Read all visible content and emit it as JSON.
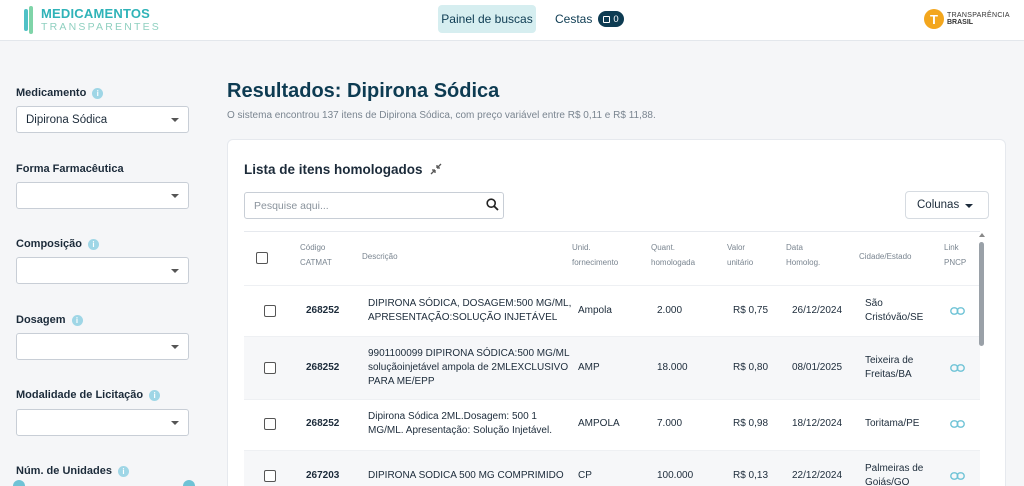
{
  "header": {
    "logo_line1": "MEDICAMENTOS",
    "logo_line2": "TRANSPARENTES",
    "nav_painel": "Painel de buscas",
    "nav_cestas": "Cestas",
    "cart_count": "0",
    "partner_line1": "TRANSPARÊNCIA",
    "partner_line2": "BRASIL",
    "partner_initial": "T"
  },
  "sidebar": {
    "filters": [
      {
        "label": "Medicamento",
        "value": "Dipirona Sódica",
        "info": true
      },
      {
        "label": "Forma Farmacêutica",
        "value": "",
        "info": false
      },
      {
        "label": "Composição",
        "value": "",
        "info": true
      },
      {
        "label": "Dosagem",
        "value": "",
        "info": true
      },
      {
        "label": "Modalidade de Licitação",
        "value": "",
        "info": true
      },
      {
        "label": "Núm. de Unidades",
        "value": "",
        "info": true
      }
    ]
  },
  "main": {
    "title": "Resultados: Dipirona Sódica",
    "subtitle": "O sistema encontrou 137 itens de Dipirona Sódica, com preço variável entre R$ 0,11 e R$ 11,88.",
    "card_title": "Lista de itens homologados",
    "search_placeholder": "Pesquise aqui...",
    "columns_label": "Colunas"
  },
  "table": {
    "headers": {
      "codigo": [
        "Código",
        "CATMAT"
      ],
      "descricao": [
        "Descrição"
      ],
      "unid": [
        "Unid.",
        "fornecimento"
      ],
      "quant": [
        "Quant.",
        "homologada"
      ],
      "valor": [
        "Valor",
        "unitário"
      ],
      "data": [
        "Data",
        "Homolog."
      ],
      "cidade": [
        "Cidade/Estado"
      ],
      "link": [
        "Link",
        "PNCP"
      ]
    },
    "rows": [
      {
        "codigo": "268252",
        "descricao": [
          "DIPIRONA SÓDICA, DOSAGEM:500 MG/ML,",
          "APRESENTAÇÃO:SOLUÇÃO INJETÁVEL"
        ],
        "unid": "Ampola",
        "quant": "2.000",
        "valor": "R$ 0,75",
        "data": "26/12/2024",
        "cidade": [
          "São",
          "Cristóvão/SE"
        ]
      },
      {
        "codigo": "268252",
        "descricao": [
          "9901100099 DIPIRONA SÓDICA:500 MG/ML",
          "soluçãoinjetável ampola de 2MLEXCLUSIVO",
          "PARA ME/EPP"
        ],
        "unid": "AMP",
        "quant": "18.000",
        "valor": "R$ 0,80",
        "data": "08/01/2025",
        "cidade": [
          "Teixeira de",
          "Freitas/BA"
        ]
      },
      {
        "codigo": "268252",
        "descricao": [
          "Dipirona Sódica 2ML.Dosagem: 500 1",
          "MG/ML. Apresentação: Solução Injetável."
        ],
        "unid": "AMPOLA",
        "quant": "7.000",
        "valor": "R$ 0,98",
        "data": "18/12/2024",
        "cidade": [
          "Toritama/PE"
        ]
      },
      {
        "codigo": "267203",
        "descricao": [
          "DIPIRONA SODICA 500 MG COMPRIMIDO"
        ],
        "unid": "CP",
        "quant": "100.000",
        "valor": "R$ 0,13",
        "data": "22/12/2024",
        "cidade": [
          "Palmeiras de",
          "Goiás/GO"
        ]
      }
    ]
  },
  "colors": {
    "brand_dark": "#0d3b52",
    "brand_teal": "#2fb3b8",
    "nav_active_bg": "#d6eef0",
    "info_icon": "#9fd6e6",
    "link_icon": "#6fc3d6",
    "partner_orange": "#f3a61d"
  }
}
